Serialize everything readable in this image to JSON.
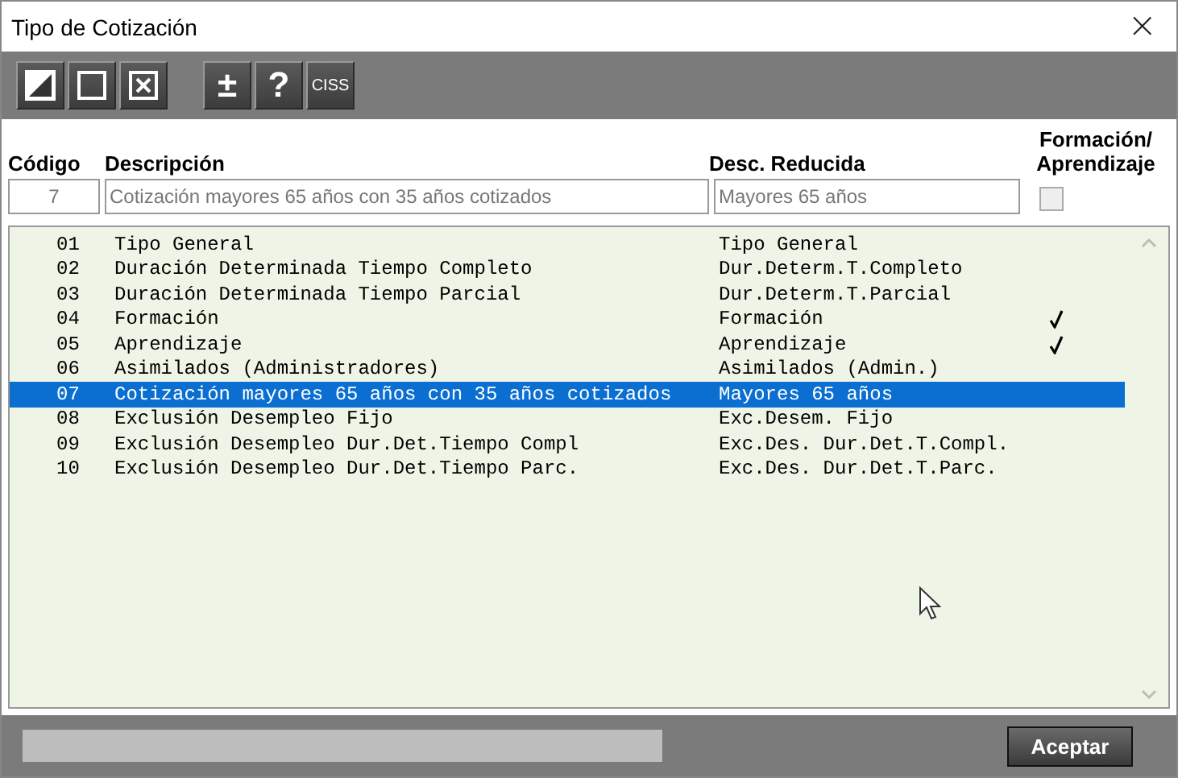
{
  "window": {
    "title": "Tipo de Cotización",
    "close": "×"
  },
  "toolbar": [
    {
      "kind": "icon"
    },
    {
      "kind": "icon"
    },
    {
      "kind": "icon"
    },
    {
      "kind": "text",
      "label": "±"
    },
    {
      "kind": "text",
      "label": "?"
    },
    {
      "kind": "small",
      "label": "CISS"
    }
  ],
  "progress": {
    "level": 0
  },
  "columns": [
    "Código",
    "Descripción",
    "Desc. Reducida",
    "Formación/\nAprendizaje"
  ],
  "form": {
    "code": "7",
    "description": "Cotización mayores 65 años con 35 años cotizados",
    "short": "Mayores 65 años",
    "checked": false
  },
  "rows": [
    {
      "code": "01",
      "description": "Tipo General",
      "short": "Tipo General",
      "checked": false,
      "selected": false
    },
    {
      "code": "02",
      "description": "Duración Determinada Tiempo Completo",
      "short": "Dur.Determ.T.Completo",
      "checked": false,
      "selected": false
    },
    {
      "code": "03",
      "description": "Duración Determinada Tiempo Parcial",
      "short": "Dur.Determ.T.Parcial",
      "checked": false,
      "selected": false
    },
    {
      "code": "04",
      "description": "Formación",
      "short": "Formación",
      "checked": true,
      "selected": false
    },
    {
      "code": "05",
      "description": "Aprendizaje",
      "short": "Aprendizaje",
      "checked": true,
      "selected": false
    },
    {
      "code": "06",
      "description": "Asimilados (Administradores)",
      "short": "Asimilados (Admin.)",
      "checked": false,
      "selected": false
    },
    {
      "code": "07",
      "description": "Cotización mayores 65 años con 35 años cotizados",
      "short": "Mayores 65 años",
      "checked": false,
      "selected": true
    },
    {
      "code": "08",
      "description": "Exclusión Desempleo Fijo",
      "short": "Exc.Desem. Fijo",
      "checked": false,
      "selected": false
    },
    {
      "code": "09",
      "description": "Exclusión Desempleo Dur.Det.Tiempo Compl",
      "short": "Exc.Des. Dur.Det.T.Compl.",
      "checked": false,
      "selected": false
    },
    {
      "code": "10",
      "description": "Exclusión Desempleo Dur.Det.Tiempo Parc.",
      "short": "Exc.Des. Dur.Det.T.Parc.",
      "checked": false,
      "selected": false
    }
  ],
  "ok_button": "Aceptar"
}
